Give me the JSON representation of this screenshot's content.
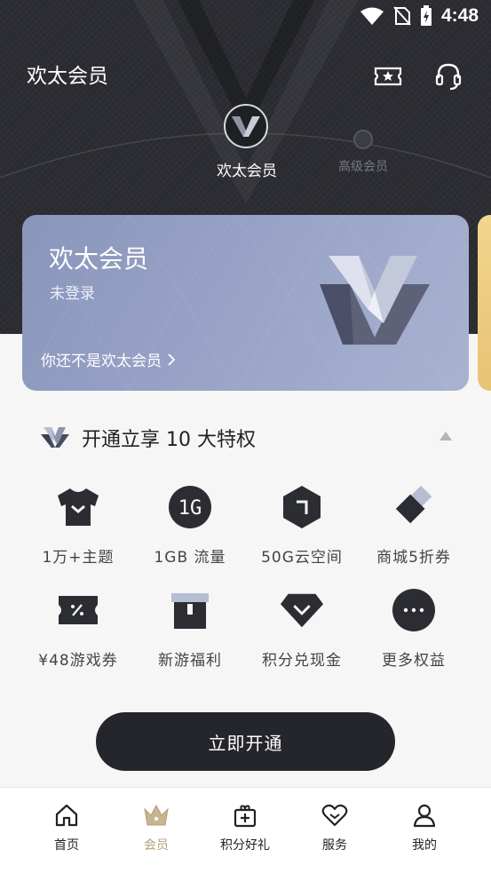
{
  "status_bar": {
    "time": "4:48"
  },
  "header": {
    "title": "欢太会员",
    "icons": [
      "ticket-star-icon",
      "headset-icon"
    ]
  },
  "levels": {
    "current": "欢太会员",
    "next": "高级会员"
  },
  "member_card": {
    "title": "欢太会员",
    "status": "未登录",
    "link": "你还不是欢太会员",
    "colors": {
      "card": "#95a0c4",
      "peek": "#eccb7f"
    }
  },
  "privileges": {
    "title": "开通立享 10 大特权",
    "items": [
      {
        "label": "1万+主题",
        "icon": "tshirt-icon"
      },
      {
        "label": "1GB 流量",
        "icon": "1g-data-icon",
        "icon_text": "1G"
      },
      {
        "label": "50G云空间",
        "icon": "cloud-storage-icon"
      },
      {
        "label": "商城5折券",
        "icon": "coupon-tag-icon"
      },
      {
        "label": "¥48游戏券",
        "icon": "game-ticket-icon"
      },
      {
        "label": "新游福利",
        "icon": "gift-box-icon"
      },
      {
        "label": "积分兑现金",
        "icon": "diamond-icon"
      },
      {
        "label": "更多权益",
        "icon": "more-icon"
      }
    ],
    "cta": "立即开通"
  },
  "bottom_nav": {
    "items": [
      {
        "label": "首页",
        "icon": "home-icon",
        "active": false
      },
      {
        "label": "会员",
        "icon": "crown-icon",
        "active": true
      },
      {
        "label": "积分好礼",
        "icon": "points-gift-icon",
        "active": false
      },
      {
        "label": "服务",
        "icon": "heart-service-icon",
        "active": false
      },
      {
        "label": "我的",
        "icon": "profile-icon",
        "active": false
      }
    ],
    "colors": {
      "active": "#b59f78",
      "inactive": "#222222"
    }
  }
}
